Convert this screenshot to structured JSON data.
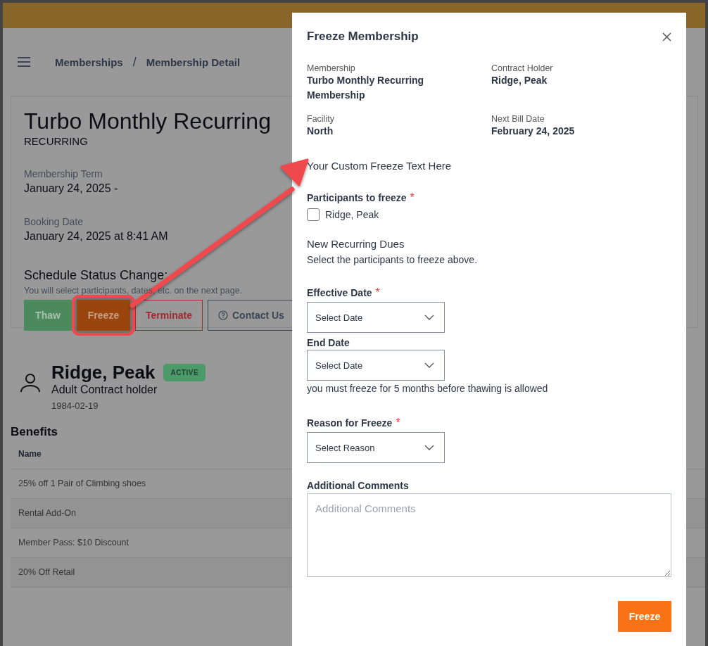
{
  "breadcrumb": [
    {
      "kind": "link",
      "text": "Memberships"
    },
    {
      "kind": "separator",
      "text": "/"
    },
    {
      "kind": "link",
      "text": "Membership Detail"
    }
  ],
  "membership": {
    "title": "Turbo Monthly Recurring",
    "type": "RECURRING",
    "fields": [
      {
        "label": "Membership Term",
        "value": "January 24, 2025 -"
      },
      {
        "label": "Booking Date",
        "value": "January 24, 2025 at 8:41 AM"
      }
    ],
    "status_change": {
      "heading": "Schedule Status Change:",
      "hint": "You will select participants, dates, etc. on the next page.",
      "buttons": [
        {
          "label": "Thaw",
          "kind": "thaw",
          "highlighted": false
        },
        {
          "label": "Freeze",
          "kind": "freeze",
          "highlighted": true
        },
        {
          "label": "Terminate",
          "kind": "terminate",
          "highlighted": false
        },
        {
          "label": "Contact Us",
          "kind": "contact",
          "highlighted": false
        }
      ]
    }
  },
  "member": {
    "name": "Ridge, Peak",
    "status": "ACTIVE",
    "role": "Adult Contract holder",
    "birth_date": "1984-02-19"
  },
  "benefits": {
    "title": "Benefits",
    "columns": [
      "Name"
    ],
    "rows": [
      "25% off 1 Pair of Climbing shoes",
      "Rental Add-On",
      "Member Pass: $10 Discount",
      "20% Off Retail"
    ]
  },
  "modal": {
    "title": "Freeze Membership",
    "details": [
      {
        "label": "Membership",
        "value": "Turbo Monthly Recurring Membership"
      },
      {
        "label": "Contract Holder",
        "value": "Ridge, Peak"
      },
      {
        "label": "Facility",
        "value": "North"
      },
      {
        "label": "Next Bill Date",
        "value": "February 24, 2025"
      }
    ],
    "custom_text": "Your Custom Freeze Text Here",
    "participants": {
      "label": "Participants to freeze",
      "required_mark": "*",
      "items": [
        {
          "name": "Ridge, Peak",
          "checked": false
        }
      ]
    },
    "dues": {
      "heading": "New Recurring Dues",
      "hint": "Select the participants to freeze above."
    },
    "effective_date": {
      "label": "Effective Date",
      "required_mark": "*",
      "placeholder": "Select Date"
    },
    "end_date": {
      "label": "End Date",
      "placeholder": "Select Date"
    },
    "end_note": "you must freeze for 5 months before thawing is allowed",
    "reason": {
      "label": "Reason for Freeze",
      "required_mark": "*",
      "placeholder": "Select Reason"
    },
    "comments": {
      "label": "Additional Comments",
      "placeholder": "Additional Comments"
    },
    "submit": "Freeze"
  }
}
